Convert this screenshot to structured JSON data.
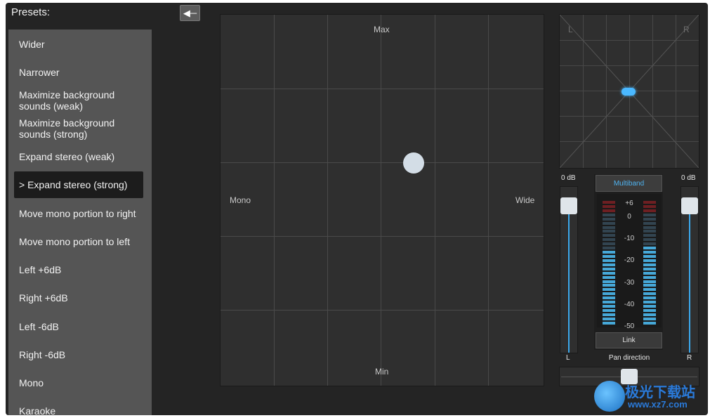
{
  "presets": {
    "title": "Presets:",
    "items": [
      {
        "label": "Wider",
        "selected": false
      },
      {
        "label": "Narrower",
        "selected": false
      },
      {
        "label": "Maximize background sounds (weak)",
        "selected": false
      },
      {
        "label": "Maximize background sounds (strong)",
        "selected": false
      },
      {
        "label": "Expand stereo (weak)",
        "selected": false
      },
      {
        "label": "> Expand stereo (strong)",
        "selected": true
      },
      {
        "label": "Move mono portion to right",
        "selected": false
      },
      {
        "label": "Move mono portion to left",
        "selected": false
      },
      {
        "label": "Left +6dB",
        "selected": false
      },
      {
        "label": "Right +6dB",
        "selected": false
      },
      {
        "label": "Left -6dB",
        "selected": false
      },
      {
        "label": "Right -6dB",
        "selected": false
      },
      {
        "label": "Mono",
        "selected": false
      },
      {
        "label": "Karaoke",
        "selected": false
      }
    ]
  },
  "toolbar": {
    "back_icon": "arrow-left-icon"
  },
  "grid": {
    "max_label": "Max",
    "min_label": "Min",
    "mono_label": "Mono",
    "wide_label": "Wide"
  },
  "scope": {
    "left_label": "L",
    "right_label": "R",
    "accent": "#4ab8ff"
  },
  "faders": {
    "left": {
      "db_label": "0 dB",
      "channel_label": "L",
      "level": 0.9
    },
    "right": {
      "db_label": "0 dB",
      "channel_label": "R",
      "level": 0.9
    }
  },
  "meter": {
    "multiband_label": "Multiband",
    "scale": [
      "+6",
      "0",
      "-10",
      "-20",
      "-30",
      "-40",
      "-50"
    ],
    "level_left": 0.61,
    "level_right": 0.64
  },
  "link_label": "Link",
  "pan": {
    "label": "Pan direction",
    "value": 0.5
  },
  "watermark": {
    "cn": "极光下载站",
    "url": "www.xz7.com"
  }
}
